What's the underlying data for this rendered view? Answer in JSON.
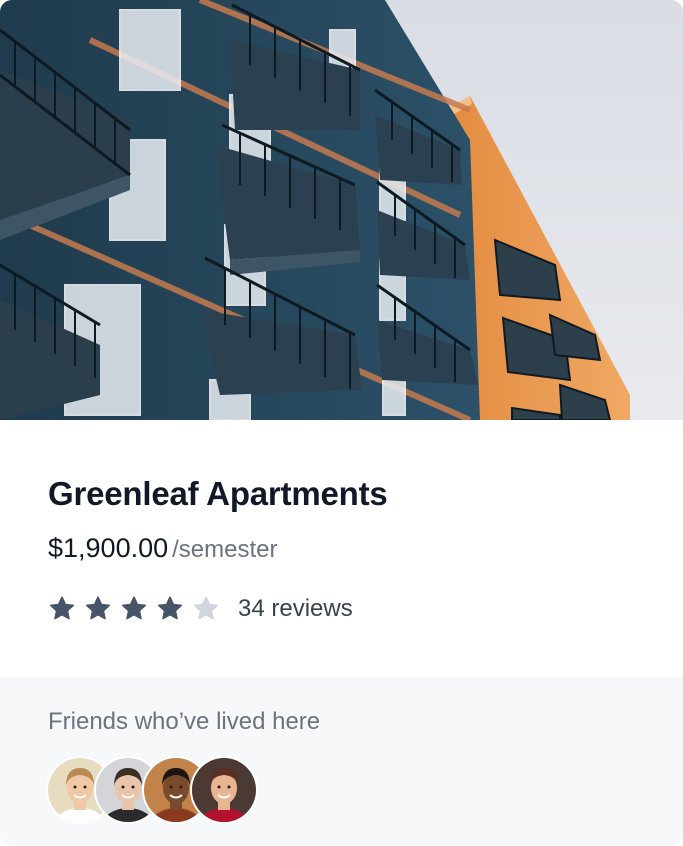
{
  "listing": {
    "image_alt": "apartment-building-photo",
    "title": "Greenleaf Apartments",
    "price": "$1,900.00",
    "period": "/semester",
    "rating": 4,
    "rating_max": 5,
    "reviews_label": "34 reviews"
  },
  "friends": {
    "label": "Friends who’ve lived here",
    "avatars": [
      {
        "bg": "#e8dcc0",
        "skin": "#f1c8a5",
        "hair": "#b98a52",
        "shirt": "#ffffff"
      },
      {
        "bg": "#d3d5d8",
        "skin": "#e9c4aa",
        "hair": "#3b2e27",
        "shirt": "#2b2b2b"
      },
      {
        "bg": "#c2834b",
        "skin": "#7a4a2c",
        "hair": "#1e1510",
        "shirt": "#8a3b1f"
      },
      {
        "bg": "#4b3a34",
        "skin": "#e8b592",
        "hair": "#5a2f22",
        "shirt": "#b3122e"
      }
    ]
  },
  "colors": {
    "star_filled": "#475569",
    "star_empty": "#d1d5db"
  }
}
